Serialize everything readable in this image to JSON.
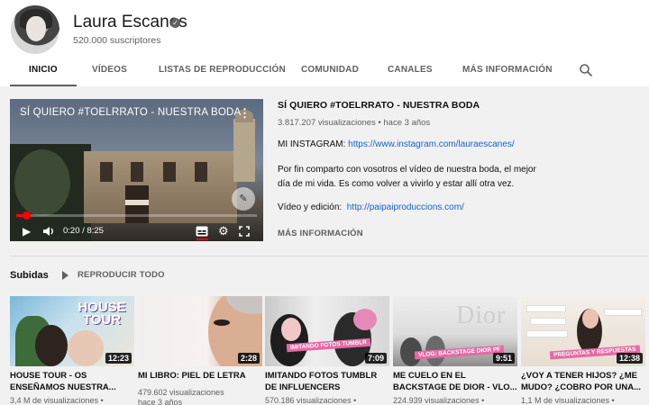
{
  "channel": {
    "name": "Laura Escanes",
    "subscribers": "520.000 suscriptores",
    "verified_mark": "✓"
  },
  "tabs": [
    {
      "label": "INICIO",
      "active": true
    },
    {
      "label": "VÍDEOS",
      "active": false
    },
    {
      "label": "LISTAS DE REPRODUCCIÓN",
      "active": false
    },
    {
      "label": "COMUNIDAD",
      "active": false
    },
    {
      "label": "CANALES",
      "active": false
    },
    {
      "label": "MÁS INFORMACIÓN",
      "active": false
    }
  ],
  "featured": {
    "player_title": "SÍ QUIERO #TOELRRATO - NUESTRA BODA",
    "title": "SÍ QUIERO #TOELRRATO - NUESTRA BODA",
    "meta": "3.817.207 visualizaciones • hace 3 años",
    "instagram_prefix": "MI INSTAGRAM:",
    "instagram_link": "https://www.instagram.com/lauraescanes/",
    "description": "Por fin comparto con vosotros el vídeo de nuestra boda, el mejor día de mi vida. Es como volver a vivirlo y estar allí otra vez.",
    "edit_prefix": "Vídeo y edición:",
    "edit_link": "http://paipaiproduccions.com/",
    "more": "MÁS INFORMACIÓN",
    "time": "0:20 / 8:25",
    "progress": 0.04
  },
  "shelf": {
    "title": "Subidas",
    "play_all": "REPRODUCIR TODO"
  },
  "videos": [
    {
      "title": "HOUSE TOUR - OS ENSEÑAMOS NUESTRA...",
      "meta": "3,4 M de visualizaciones •",
      "meta2": "",
      "duration": "12:23",
      "thumb_text": "HOUSE TOUR"
    },
    {
      "title": "MI LIBRO: PIEL DE LETRA",
      "meta": "479.602 visualizaciones",
      "meta2": "hace 3 años",
      "duration": "2:28",
      "thumb_text": ""
    },
    {
      "title": "IMITANDO FOTOS TUMBLR DE INFLUENCERS",
      "meta": "570.186 visualizaciones •",
      "meta2": "",
      "duration": "7:09",
      "thumb_text": "IMITANDO FOTOS TUMBLR"
    },
    {
      "title": "ME CUELO EN EL BACKSTAGE DE DIOR - VLO...",
      "meta": "224.939 visualizaciones •",
      "meta2": "",
      "duration": "9:51",
      "thumb_text": "VLOG: BACKSTAGE DIOR PF"
    },
    {
      "title": "¿VOY A TENER HIJOS? ¿ME MUDO? ¿COBRO POR UNA...",
      "meta": "1,1 M de visualizaciones •",
      "meta2": "",
      "duration": "12:38",
      "thumb_text": "PREGUNTAS Y RESPUESTAS"
    }
  ]
}
